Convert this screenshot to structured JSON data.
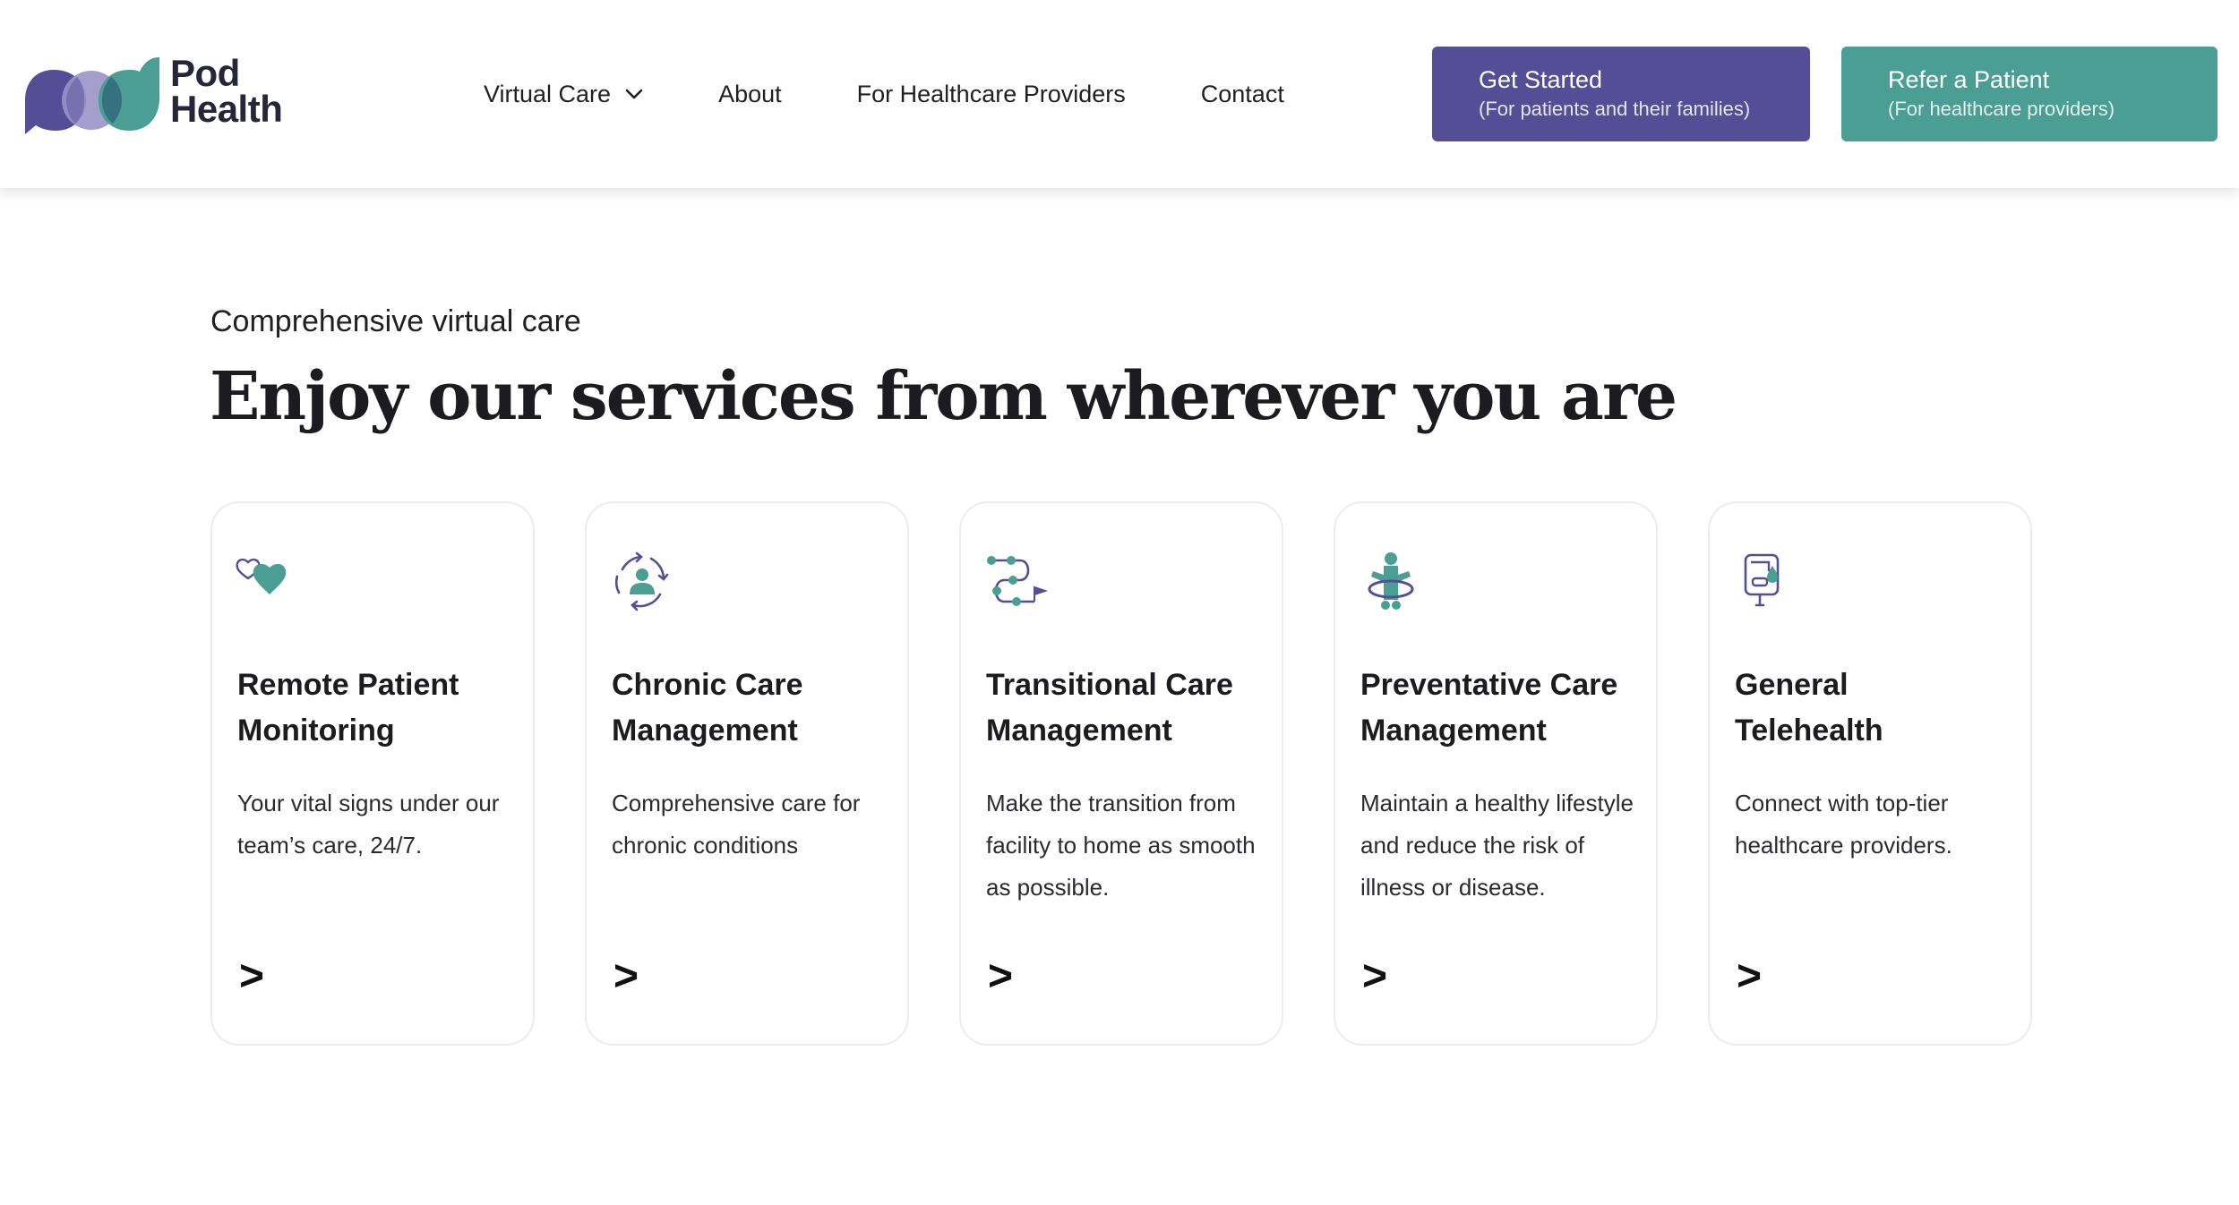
{
  "brand": {
    "name_line1": "Pod",
    "name_line2": "Health",
    "colors": {
      "purple": "#544e97",
      "teal": "#4b9e94",
      "lavender": "#9a93c8"
    }
  },
  "nav": {
    "items": [
      {
        "label": "Virtual Care",
        "has_dropdown": true,
        "icon": "chevron-down-icon"
      },
      {
        "label": "About"
      },
      {
        "label": "For Healthcare Providers"
      },
      {
        "label": "Contact"
      }
    ]
  },
  "cta": {
    "primary": {
      "title": "Get Started",
      "subtitle": "(For patients and their families)",
      "color": "#544e97"
    },
    "secondary": {
      "title": "Refer a Patient",
      "subtitle": "(For healthcare providers)",
      "color": "#4b9e94"
    }
  },
  "services": {
    "eyebrow": "Comprehensive virtual care",
    "headline": "Enjoy our services from wherever you are",
    "cards": [
      {
        "title_line1": "Remote Patient",
        "title_line2": "Monitoring",
        "description": "Your vital signs under our team’s care, 24/7.",
        "icon": "heart-monitor-icon",
        "arrow": ">"
      },
      {
        "title_line1": "Chronic Care",
        "title_line2": "Management",
        "description": "Comprehensive care for chronic conditions",
        "icon": "person-cycle-icon",
        "arrow": ">"
      },
      {
        "title_line1": "Transitional Care",
        "title_line2": "Management",
        "description": "Make the transition from facility to home as smooth as possible.",
        "icon": "path-flag-icon",
        "arrow": ">"
      },
      {
        "title_line1": "Preventative Care",
        "title_line2": "Management",
        "description": "Maintain a healthy lifestyle and reduce the risk of illness or disease.",
        "icon": "hula-hoop-icon",
        "arrow": ">"
      },
      {
        "title_line1": "General",
        "title_line2": "Telehealth",
        "description": "Connect with top-tier healthcare providers.",
        "icon": "iv-drip-icon",
        "arrow": ">"
      }
    ]
  }
}
